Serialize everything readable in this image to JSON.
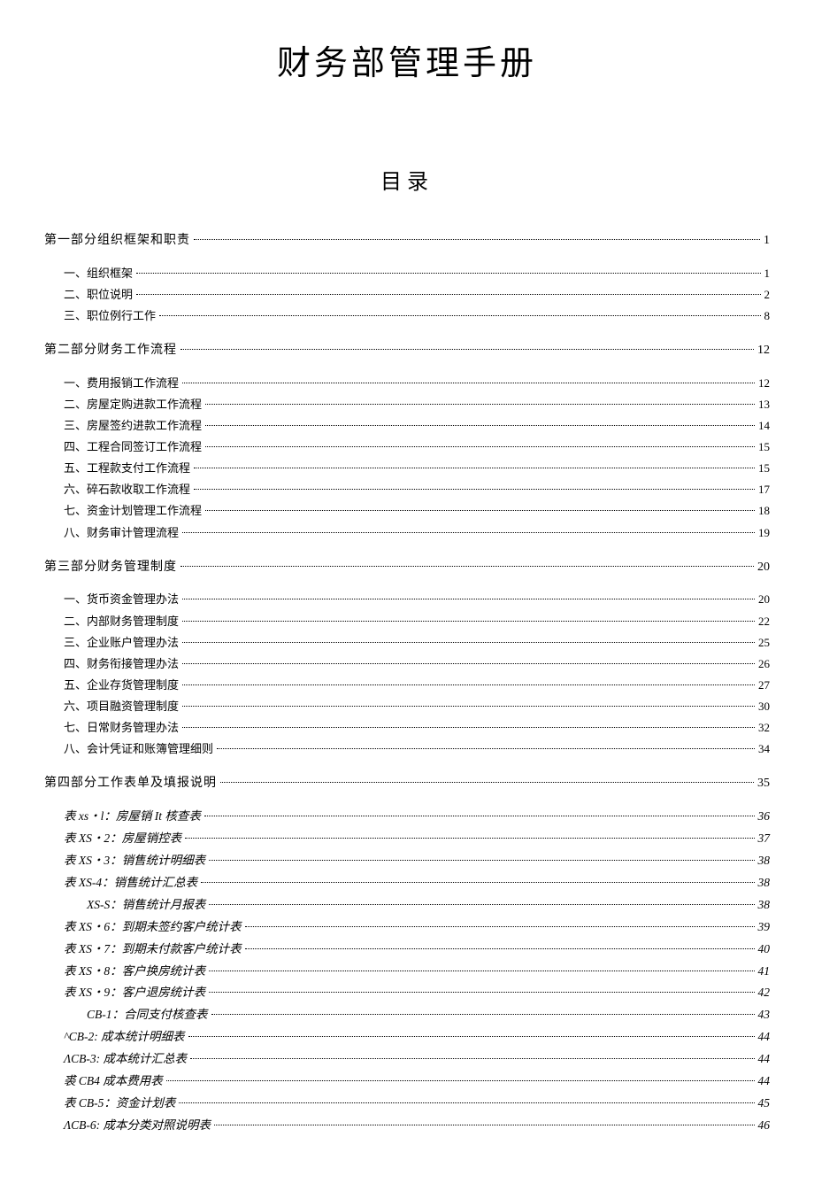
{
  "title": "财务部管理手册",
  "tocTitle": "目录",
  "sections": [
    {
      "label": "第一部分组织框架和职责",
      "page": "1",
      "level": 1,
      "items": [
        {
          "label": "一、组织框架",
          "page": "1",
          "level": 2
        },
        {
          "label": "二、职位说明",
          "page": "2",
          "level": 2
        },
        {
          "label": "三、职位例行工作",
          "page": "8",
          "level": 2
        }
      ]
    },
    {
      "label": "第二部分财务工作流程",
      "page": "12",
      "level": 1,
      "items": [
        {
          "label": "一、费用报销工作流程",
          "page": "12",
          "level": 2
        },
        {
          "label": "二、房屋定购进款工作流程",
          "page": "13",
          "level": 2
        },
        {
          "label": "三、房屋签约进款工作流程",
          "page": "14",
          "level": 2
        },
        {
          "label": "四、工程合同签订工作流程",
          "page": "15",
          "level": 2
        },
        {
          "label": "五、工程款支付工作流程",
          "page": "15",
          "level": 2
        },
        {
          "label": "六、碎石款收取工作流程",
          "page": "17",
          "level": 2
        },
        {
          "label": "七、资金计划管理工作流程",
          "page": "18",
          "level": 2
        },
        {
          "label": "八、财务审计管理流程",
          "page": "19",
          "level": 2
        }
      ]
    },
    {
      "label": "第三部分财务管理制度",
      "page": "20",
      "level": 1,
      "items": [
        {
          "label": "一、货币资金管理办法",
          "page": "20",
          "level": 2
        },
        {
          "label": "二、内部财务管理制度",
          "page": "22",
          "level": 2
        },
        {
          "label": "三、企业账户管理办法",
          "page": "25",
          "level": 2
        },
        {
          "label": "四、财务衔接管理办法",
          "page": "26",
          "level": 2
        },
        {
          "label": "五、企业存货管理制度",
          "page": "27",
          "level": 2
        },
        {
          "label": "六、项目融资管理制度",
          "page": "30",
          "level": 2
        },
        {
          "label": "七、日常财务管理办法",
          "page": "32",
          "level": 2
        },
        {
          "label": "八、会计凭证和账簿管理细则",
          "page": "34",
          "level": 2
        }
      ]
    },
    {
      "label": "第四部分工作表单及填报说明",
      "page": "35",
      "level": 1,
      "items": [
        {
          "label": "表 xs・l：房屋销 It 核查表",
          "page": "36",
          "level": 3
        },
        {
          "label": "表 XS・2：房屋销控表",
          "page": "37",
          "level": 3
        },
        {
          "label": "表 XS・3：销售统计明细表",
          "page": "38",
          "level": 3
        },
        {
          "label": "表 XS-4：销售统计汇总表",
          "page": "38",
          "level": 3
        },
        {
          "label": "XS-S：销售统计月报表",
          "page": "38",
          "level": 3,
          "extraIndent": true
        },
        {
          "label": "表 XS・6：到期未签约客户统计表",
          "page": "39",
          "level": 3
        },
        {
          "label": "表 XS・7：到期未付款客户统计表",
          "page": "40",
          "level": 3
        },
        {
          "label": "表 XS・8：客户换房统计表",
          "page": "41",
          "level": 3
        },
        {
          "label": "表 XS・9：客户退房统计表",
          "page": "42",
          "level": 3
        },
        {
          "label": "CB-1：合同支付核查表",
          "page": "43",
          "level": 3,
          "extraIndent": true
        },
        {
          "label": "^CB-2: 成本统计明细表",
          "page": "44",
          "level": 3
        },
        {
          "label": "ΛCB-3: 成本统计汇总表",
          "page": "44",
          "level": 3
        },
        {
          "label": "裘 CB4 成本费用表",
          "page": "44",
          "level": 3
        },
        {
          "label": "表 CB-5：资金计划表",
          "page": "45",
          "level": 3
        },
        {
          "label": "ΛCB-6: 成本分类对照说明表",
          "page": "46",
          "level": 3
        }
      ]
    }
  ]
}
